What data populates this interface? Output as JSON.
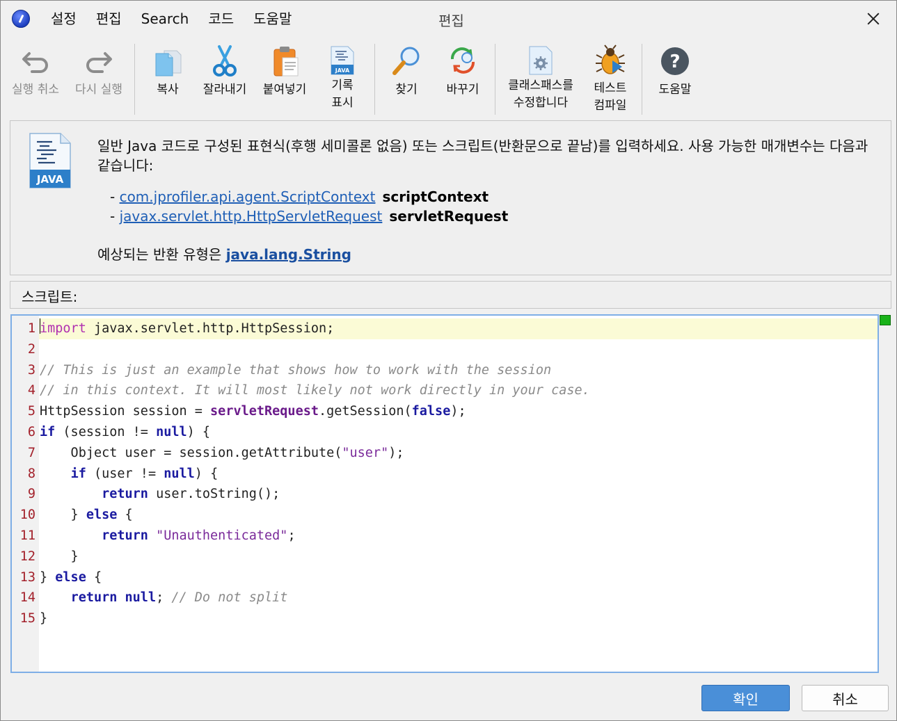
{
  "menu": {
    "items": [
      "설정",
      "편집",
      "Search",
      "코드",
      "도움말"
    ]
  },
  "window_title": "편집",
  "toolbar": {
    "undo": "실행 취소",
    "redo": "다시 실행",
    "copy": "복사",
    "cut": "잘라내기",
    "paste": "붙여넣기",
    "log_line1": "기록",
    "log_line2": "표시",
    "find": "찾기",
    "replace": "바꾸기",
    "classpath_line1": "클래스패스를",
    "classpath_line2": "수정합니다",
    "test_line1": "테스트",
    "test_line2": "컴파일",
    "help": "도움말"
  },
  "info": {
    "logo_text": "JAVA",
    "description": "일반 Java 코드로 구성된 표현식(후행 세미콜론 없음) 또는 스크립트(반환문으로 끝남)를 입력하세요. 사용 가능한 매개변수는 다음과 같습니다:",
    "params": [
      {
        "prefix": "- ",
        "type": "com.jprofiler.api.agent.ScriptContext",
        "name": "scriptContext"
      },
      {
        "prefix": "- ",
        "type": "javax.servlet.http.HttpServletRequest",
        "name": "servletRequest"
      }
    ],
    "return_prefix": "예상되는 반환 유형은 ",
    "return_type": "java.lang.String"
  },
  "script_label": "스크립트:",
  "editor": {
    "line_numbers": [
      "1",
      "2",
      "3",
      "4",
      "5",
      "6",
      "7",
      "8",
      "9",
      "10",
      "11",
      "12",
      "13",
      "14",
      "15"
    ]
  },
  "buttons": {
    "ok": "확인",
    "cancel": "취소"
  },
  "colors": {
    "accent": "#4a8fd8",
    "link": "#1f5fb6",
    "keyword": "#1a1aa0",
    "comment": "#8a8a8a",
    "line_number": "#a3202a",
    "status_ok": "#19b219"
  }
}
